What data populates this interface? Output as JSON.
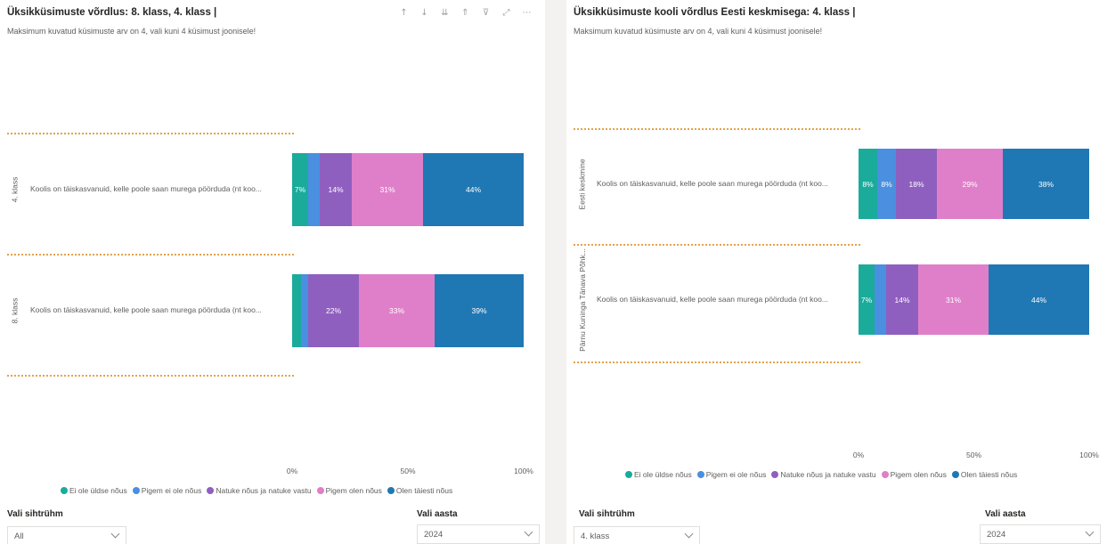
{
  "colors": {
    "ei_ole": "#1aab9b",
    "pigem_ei": "#4a8fe0",
    "natuke": "#8f5fbf",
    "pigem_olen": "#e07fc9",
    "olen_taiesti": "#1f78b4",
    "divider": "#e3a34b"
  },
  "toolbar_icons": [
    "arrow-up-icon",
    "arrow-down-icon",
    "drill-all-icon",
    "expand-hierarchy-icon",
    "filter-icon",
    "focus-mode-icon",
    "more-options-icon"
  ],
  "toolbar_glyphs": [
    "↑",
    "↓",
    "⇊",
    "⇑",
    "⊽",
    "⤢",
    "⋯"
  ],
  "left": {
    "title": "Üksikküsimuste võrdlus: 8. klass, 4. klass |",
    "subtitle": "Maksimum kuvatud küsimuste arv on 4, vali kuni 4 küsimust joonisele!",
    "rows": [
      {
        "category": "4. klass",
        "question": "Koolis on täiskasvanuid, kelle poole saan murega pöörduda (nt koo...",
        "segments": [
          {
            "key": "ei_ole",
            "value": 7,
            "label": "7%"
          },
          {
            "key": "pigem_ei",
            "value": 5,
            "label": ""
          },
          {
            "key": "natuke",
            "value": 14,
            "label": "14%"
          },
          {
            "key": "pigem_olen",
            "value": 31,
            "label": "31%"
          },
          {
            "key": "olen_taiesti",
            "value": 44,
            "label": "44%"
          }
        ]
      },
      {
        "category": "8. klass",
        "question": "Koolis on täiskasvanuid, kelle poole saan murega pöörduda (nt koo...",
        "segments": [
          {
            "key": "ei_ole",
            "value": 4,
            "label": ""
          },
          {
            "key": "pigem_ei",
            "value": 3,
            "label": ""
          },
          {
            "key": "natuke",
            "value": 22,
            "label": "22%"
          },
          {
            "key": "pigem_olen",
            "value": 33,
            "label": "33%"
          },
          {
            "key": "olen_taiesti",
            "value": 39,
            "label": "39%"
          }
        ]
      }
    ],
    "x_ticks": [
      "0%",
      "50%",
      "100%"
    ],
    "slicer_target_label": "Vali sihtrühm",
    "slicer_target_value": "All",
    "slicer_year_label": "Vali aasta",
    "slicer_year_value": "2024"
  },
  "right": {
    "title": "Üksikküsimuste kooli võrdlus Eesti keskmisega: 4. klass |",
    "subtitle": "Maksimum kuvatud küsimuste arv on 4, vali kuni 4 küsimust joonisele!",
    "rows": [
      {
        "category": "Eesti keskmine",
        "question": "Koolis on täiskasvanuid, kelle poole saan murega pöörduda (nt koo...",
        "segments": [
          {
            "key": "ei_ole",
            "value": 8,
            "label": "8%"
          },
          {
            "key": "pigem_ei",
            "value": 8,
            "label": "8%"
          },
          {
            "key": "natuke",
            "value": 18,
            "label": "18%"
          },
          {
            "key": "pigem_olen",
            "value": 29,
            "label": "29%"
          },
          {
            "key": "olen_taiesti",
            "value": 38,
            "label": "38%"
          }
        ]
      },
      {
        "category": "Pärnu Kuninga Tänava Põhk...",
        "question": "Koolis on täiskasvanuid, kelle poole saan murega pöörduda (nt koo...",
        "segments": [
          {
            "key": "ei_ole",
            "value": 7,
            "label": "7%"
          },
          {
            "key": "pigem_ei",
            "value": 5,
            "label": ""
          },
          {
            "key": "natuke",
            "value": 14,
            "label": "14%"
          },
          {
            "key": "pigem_olen",
            "value": 31,
            "label": "31%"
          },
          {
            "key": "olen_taiesti",
            "value": 44,
            "label": "44%"
          }
        ]
      }
    ],
    "x_ticks": [
      "0%",
      "50%",
      "100%"
    ],
    "slicer_target_label": "Vali sihtrühm",
    "slicer_target_value": "4. klass",
    "slicer_year_label": "Vali aasta",
    "slicer_year_value": "2024"
  },
  "legend": [
    {
      "key": "ei_ole",
      "label": "Ei ole üldse nõus"
    },
    {
      "key": "pigem_ei",
      "label": "Pigem ei ole nõus"
    },
    {
      "key": "natuke",
      "label": "Natuke nõus ja natuke vastu"
    },
    {
      "key": "pigem_olen",
      "label": "Pigem olen nõus"
    },
    {
      "key": "olen_taiesti",
      "label": "Olen täiesti nõus"
    }
  ]
}
